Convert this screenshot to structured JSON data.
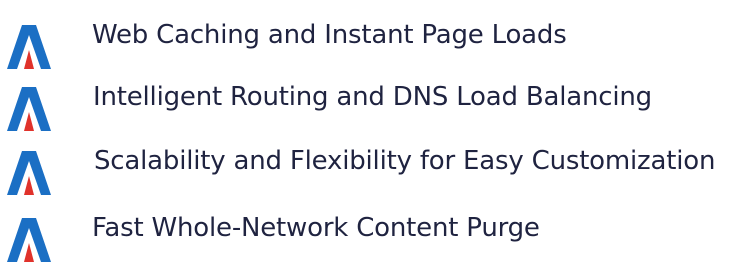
{
  "features": [
    {
      "label": "Web Caching and Instant Page Loads",
      "icon": "stylized-a-logo-icon"
    },
    {
      "label": "Intelligent Routing and DNS Load Balancing",
      "icon": "stylized-a-logo-icon"
    },
    {
      "label": "Scalability and Flexibility for Easy Customization",
      "icon": "stylized-a-logo-icon"
    },
    {
      "label": "Fast Whole-Network Content Purge",
      "icon": "stylized-a-logo-icon"
    }
  ],
  "colors": {
    "logo_blue": "#1b6fc4",
    "logo_red": "#e0322b",
    "text": "#1f2340",
    "background": "#ffffff"
  }
}
